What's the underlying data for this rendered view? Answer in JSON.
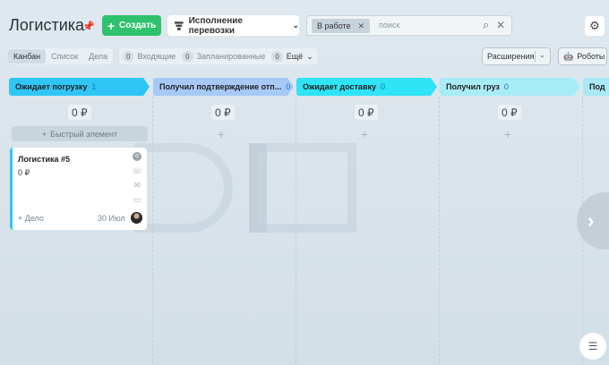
{
  "header": {
    "title": "Логистика",
    "create_label": "Создать",
    "pipeline_label": "Исполнение перевозки",
    "filter_chip": "В работе",
    "search_placeholder": "поиск"
  },
  "views": [
    "Канбан",
    "Список",
    "Дела"
  ],
  "counters": [
    {
      "count": "0",
      "label": "Входящие"
    },
    {
      "count": "0",
      "label": "Запланированные"
    },
    {
      "count": "0",
      "label": "Ещё"
    }
  ],
  "toolbar": {
    "extensions_label": "Расширения",
    "robots_label": "Роботы"
  },
  "stages": [
    {
      "name": "Ожидает погрузку",
      "count": "1",
      "sum": "0 ₽",
      "color": "#2fc6f6"
    },
    {
      "name": "Получил подтверждение отп...",
      "count": "0",
      "sum": "0 ₽",
      "color": "#a7c9f7"
    },
    {
      "name": "Ожидает доставку",
      "count": "0",
      "sum": "0 ₽",
      "color": "#2fe4f6"
    },
    {
      "name": "Получил груз",
      "count": "0",
      "sum": "0 ₽",
      "color": "#a8ecf8"
    },
    {
      "name": "Под",
      "count": "",
      "sum": "",
      "color": "#a8e9f5"
    }
  ],
  "quick_add_label": "Быстрый элемент",
  "card": {
    "title": "Логистика #5",
    "sum": "0 ₽",
    "add_task": "+ Дело",
    "date": "30 Июл"
  }
}
